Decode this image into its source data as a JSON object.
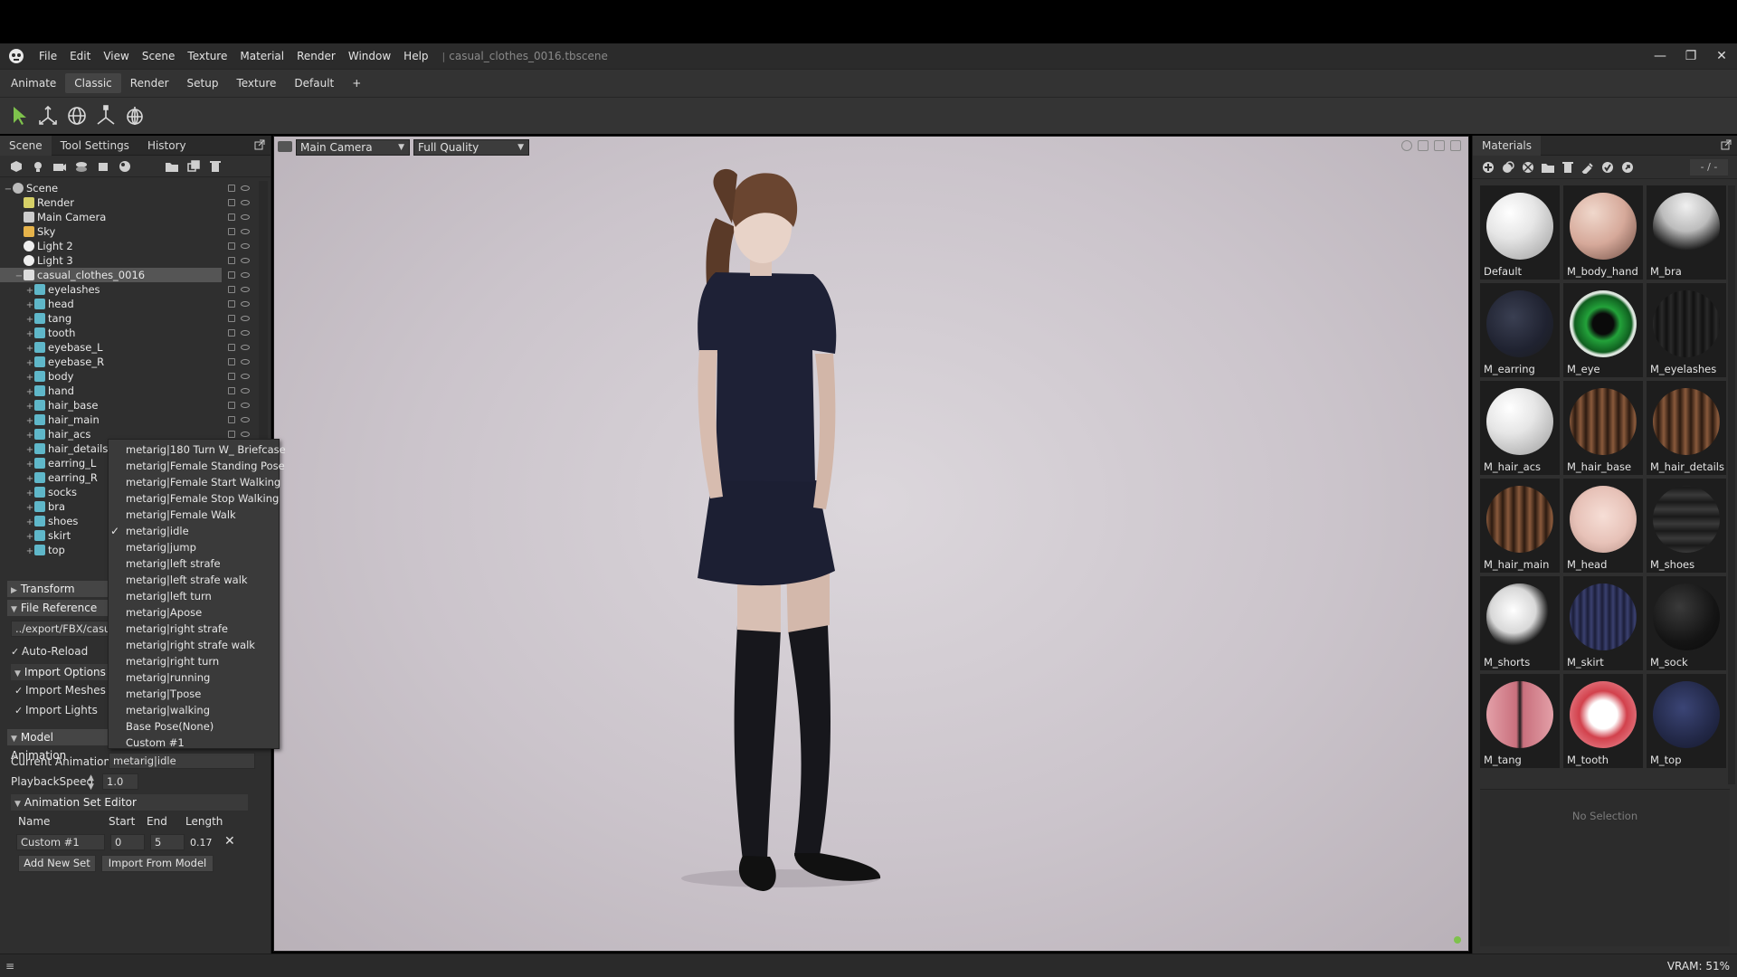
{
  "app": {
    "menus": [
      "File",
      "Edit",
      "View",
      "Scene",
      "Texture",
      "Material",
      "Render",
      "Window",
      "Help"
    ],
    "doc_title": "casual_clothes_0016.tbscene",
    "separator": "|"
  },
  "window_controls": {
    "minimize": "—",
    "maximize": "❐",
    "close": "✕"
  },
  "layouts": {
    "tabs": [
      "Animate",
      "Classic",
      "Render",
      "Setup",
      "Texture",
      "Default",
      "+"
    ],
    "active": "Classic"
  },
  "left_panel": {
    "tabs": [
      "Scene",
      "Tool Settings",
      "History"
    ],
    "active_tab": "Scene",
    "tree": [
      {
        "label": "Scene",
        "depth": 0,
        "icon": "scene",
        "expander": "−"
      },
      {
        "label": "Render",
        "depth": 1,
        "icon": "render"
      },
      {
        "label": "Main Camera",
        "depth": 1,
        "icon": "camera"
      },
      {
        "label": "Sky",
        "depth": 1,
        "icon": "sky"
      },
      {
        "label": "Light 2",
        "depth": 1,
        "icon": "light"
      },
      {
        "label": "Light 3",
        "depth": 1,
        "icon": "light"
      },
      {
        "label": "casual_clothes_0016",
        "depth": 1,
        "icon": "model",
        "selected": true,
        "expander": "−"
      },
      {
        "label": "eyelashes",
        "depth": 2,
        "icon": "mesh",
        "expander": "+"
      },
      {
        "label": "head",
        "depth": 2,
        "icon": "mesh",
        "expander": "+"
      },
      {
        "label": "tang",
        "depth": 2,
        "icon": "mesh",
        "expander": "+"
      },
      {
        "label": "tooth",
        "depth": 2,
        "icon": "mesh",
        "expander": "+"
      },
      {
        "label": "eyebase_L",
        "depth": 2,
        "icon": "mesh",
        "expander": "+"
      },
      {
        "label": "eyebase_R",
        "depth": 2,
        "icon": "mesh",
        "expander": "+"
      },
      {
        "label": "body",
        "depth": 2,
        "icon": "mesh",
        "expander": "+"
      },
      {
        "label": "hand",
        "depth": 2,
        "icon": "mesh",
        "expander": "+"
      },
      {
        "label": "hair_base",
        "depth": 2,
        "icon": "mesh",
        "expander": "+"
      },
      {
        "label": "hair_main",
        "depth": 2,
        "icon": "mesh",
        "expander": "+"
      },
      {
        "label": "hair_acs",
        "depth": 2,
        "icon": "mesh",
        "expander": "+"
      },
      {
        "label": "hair_details",
        "depth": 2,
        "icon": "mesh",
        "expander": "+"
      },
      {
        "label": "earring_L",
        "depth": 2,
        "icon": "mesh",
        "expander": "+"
      },
      {
        "label": "earring_R",
        "depth": 2,
        "icon": "mesh",
        "expander": "+"
      },
      {
        "label": "socks",
        "depth": 2,
        "icon": "mesh",
        "expander": "+"
      },
      {
        "label": "bra",
        "depth": 2,
        "icon": "mesh",
        "expander": "+"
      },
      {
        "label": "shoes",
        "depth": 2,
        "icon": "mesh",
        "expander": "+"
      },
      {
        "label": "skirt",
        "depth": 2,
        "icon": "mesh",
        "expander": "+"
      },
      {
        "label": "top",
        "depth": 2,
        "icon": "mesh",
        "expander": "+"
      }
    ],
    "transform_header": "Transform",
    "file_reference_header": "File Reference",
    "file_path": "../export/FBX/casual_clothes_0016.fbx",
    "auto_reload": "Auto-Reload",
    "import_options_header": "Import Options",
    "import_meshes": "Import Meshes",
    "import_lights": "Import Lights",
    "model_animation_header": "Model Animation",
    "current_animation_label": "Current Animation:",
    "current_animation_value": "metarig|idle",
    "playback_speed_label": "PlaybackSpeed",
    "playback_speed_value": "1.0",
    "anim_set_editor_header": "Animation Set Editor",
    "anim_cols": [
      "Name",
      "Start",
      "End",
      "Length"
    ],
    "anim_row": {
      "name": "Custom #1",
      "start": "0",
      "end": "5",
      "length": "0.17"
    },
    "add_new_set": "Add New Set",
    "import_from_model": "Import From Model"
  },
  "animation_dropdown": {
    "items": [
      "metarig|180 Turn W_ Briefcase",
      "metarig|Female Standing Pose",
      "metarig|Female Start Walking",
      "metarig|Female Stop Walking",
      "metarig|Female Walk",
      "metarig|idle",
      "metarig|jump",
      "metarig|left strafe",
      "metarig|left strafe walk",
      "metarig|left turn",
      "metarig|Apose",
      "metarig|right strafe",
      "metarig|right strafe walk",
      "metarig|right turn",
      "metarig|running",
      "metarig|Tpose",
      "metarig|walking",
      "Base Pose(None)",
      "Custom #1"
    ],
    "checked": "metarig|idle",
    "check_glyph": "✓"
  },
  "viewport": {
    "camera": "Main Camera",
    "quality": "Full Quality"
  },
  "materials": {
    "title": "Materials",
    "counter": "- / -",
    "items": [
      {
        "name": "Default",
        "swatch": "white"
      },
      {
        "name": "M_body_hand",
        "swatch": "skin"
      },
      {
        "name": "M_bra",
        "swatch": "bra"
      },
      {
        "name": "M_earring",
        "swatch": "earring"
      },
      {
        "name": "M_eye",
        "swatch": "eye"
      },
      {
        "name": "M_eyelashes",
        "swatch": "lash"
      },
      {
        "name": "M_hair_acs",
        "swatch": "white"
      },
      {
        "name": "M_hair_base",
        "swatch": "hair"
      },
      {
        "name": "M_hair_details",
        "swatch": "hair"
      },
      {
        "name": "M_hair_main",
        "swatch": "hair"
      },
      {
        "name": "M_head",
        "swatch": "face"
      },
      {
        "name": "M_shoes",
        "swatch": "shoes"
      },
      {
        "name": "M_shorts",
        "swatch": "shorts"
      },
      {
        "name": "M_skirt",
        "swatch": "skirt"
      },
      {
        "name": "M_sock",
        "swatch": "sock"
      },
      {
        "name": "M_tang",
        "swatch": "tang"
      },
      {
        "name": "M_tooth",
        "swatch": "tooth"
      },
      {
        "name": "M_top",
        "swatch": "top"
      }
    ],
    "no_selection": "No Selection"
  },
  "status": {
    "vram": "VRAM: 51%"
  },
  "colors": {
    "accent_green": "#7ec24c",
    "selected_row": "#555555"
  }
}
